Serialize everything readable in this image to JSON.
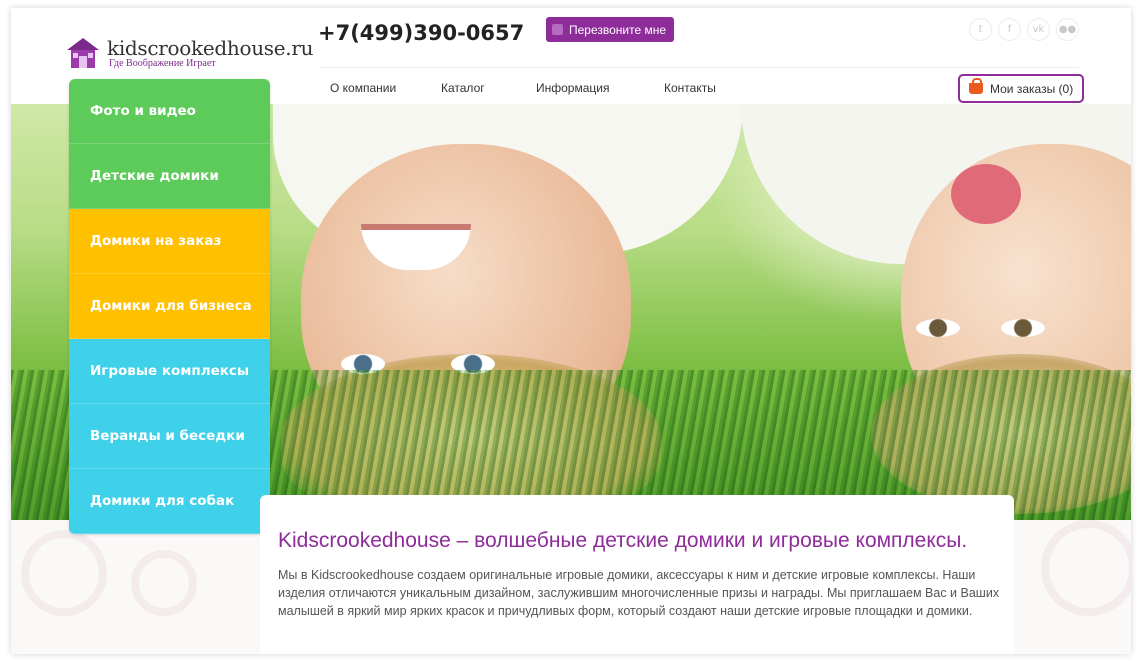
{
  "header": {
    "logo_text": "kidscrookedhouse.ru",
    "logo_tagline": "Где Воображение Играет",
    "phone": "+7(499)390-0657",
    "callback_label": "Перезвоните мне",
    "socials": [
      {
        "icon": "twitter-icon",
        "glyph": "𝕥"
      },
      {
        "icon": "facebook-icon",
        "glyph": "f"
      },
      {
        "icon": "vk-icon",
        "glyph": "vk"
      },
      {
        "icon": "flickr-icon",
        "glyph": "●●"
      }
    ]
  },
  "nav": {
    "items": [
      "О компании",
      "Каталог",
      "Информация",
      "Контакты"
    ],
    "orders_label": "Мои заказы (0)"
  },
  "sidebar": {
    "items": [
      {
        "label": "Фото и видео",
        "color": "#5dcb5a"
      },
      {
        "label": "Детские домики",
        "color": "#5dcb5a"
      },
      {
        "label": "Домики на заказ",
        "color": "#ffc000"
      },
      {
        "label": "Домики для бизнеса",
        "color": "#ffc000"
      },
      {
        "label": "Игровые комплексы",
        "color": "#3fd0ea"
      },
      {
        "label": "Веранды и беседки",
        "color": "#3fd0ea"
      },
      {
        "label": "Домики для собак",
        "color": "#3fd0ea"
      }
    ]
  },
  "main": {
    "title": "Kidscrookedhouse – волшебные детские домики и игровые комплексы.",
    "description": "Мы в Kidscrookedhouse создаем оригинальные игровые домики, аксессуары к ним и детские игровые комплексы. Наши изделия отличаются уникальным дизайном, заслужившим многочисленные призы и награды. Мы приглашаем Вас и Ваших малышей в яркий мир ярких красок и причудливых форм, который создают наши детские игровые площадки и домики."
  },
  "colors": {
    "brand": "#8e2c9a",
    "accent": "#e85a1e"
  }
}
